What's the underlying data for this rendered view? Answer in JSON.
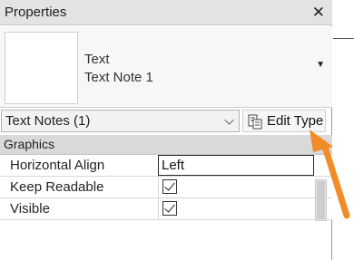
{
  "window": {
    "title": "Properties",
    "close_symbol": "✕"
  },
  "type_selector": {
    "family": "Text",
    "type_name": "Text Note 1",
    "dropdown_symbol": "▼"
  },
  "instance_filter": {
    "selected": "Text Notes (1)"
  },
  "edit_type": {
    "label": "Edit Type",
    "icon": "edit-type-icon"
  },
  "properties": {
    "group": "Graphics",
    "rows": [
      {
        "name": "Horizontal Align",
        "value": "Left",
        "kind": "text"
      },
      {
        "name": "Keep Readable",
        "checked": true,
        "kind": "checkbox"
      },
      {
        "name": "Visible",
        "checked": true,
        "kind": "checkbox"
      }
    ]
  },
  "annotation": {
    "arrow_color": "#f28c28",
    "points_to": "edit-type-button"
  }
}
